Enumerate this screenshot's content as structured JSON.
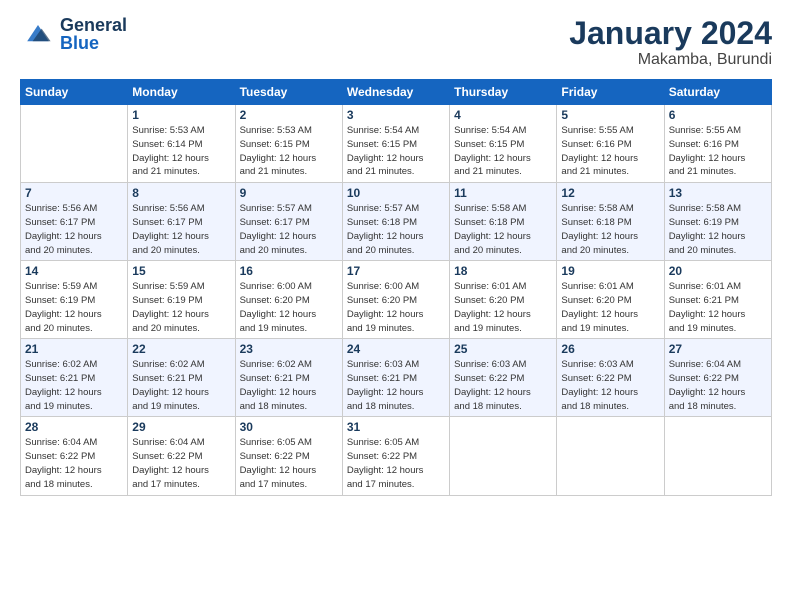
{
  "header": {
    "logo_general": "General",
    "logo_blue": "Blue",
    "month_year": "January 2024",
    "location": "Makamba, Burundi"
  },
  "weekdays": [
    "Sunday",
    "Monday",
    "Tuesday",
    "Wednesday",
    "Thursday",
    "Friday",
    "Saturday"
  ],
  "weeks": [
    [
      {
        "day": "",
        "info": ""
      },
      {
        "day": "1",
        "info": "Sunrise: 5:53 AM\nSunset: 6:14 PM\nDaylight: 12 hours\nand 21 minutes."
      },
      {
        "day": "2",
        "info": "Sunrise: 5:53 AM\nSunset: 6:15 PM\nDaylight: 12 hours\nand 21 minutes."
      },
      {
        "day": "3",
        "info": "Sunrise: 5:54 AM\nSunset: 6:15 PM\nDaylight: 12 hours\nand 21 minutes."
      },
      {
        "day": "4",
        "info": "Sunrise: 5:54 AM\nSunset: 6:15 PM\nDaylight: 12 hours\nand 21 minutes."
      },
      {
        "day": "5",
        "info": "Sunrise: 5:55 AM\nSunset: 6:16 PM\nDaylight: 12 hours\nand 21 minutes."
      },
      {
        "day": "6",
        "info": "Sunrise: 5:55 AM\nSunset: 6:16 PM\nDaylight: 12 hours\nand 21 minutes."
      }
    ],
    [
      {
        "day": "7",
        "info": "Sunrise: 5:56 AM\nSunset: 6:17 PM\nDaylight: 12 hours\nand 20 minutes."
      },
      {
        "day": "8",
        "info": "Sunrise: 5:56 AM\nSunset: 6:17 PM\nDaylight: 12 hours\nand 20 minutes."
      },
      {
        "day": "9",
        "info": "Sunrise: 5:57 AM\nSunset: 6:17 PM\nDaylight: 12 hours\nand 20 minutes."
      },
      {
        "day": "10",
        "info": "Sunrise: 5:57 AM\nSunset: 6:18 PM\nDaylight: 12 hours\nand 20 minutes."
      },
      {
        "day": "11",
        "info": "Sunrise: 5:58 AM\nSunset: 6:18 PM\nDaylight: 12 hours\nand 20 minutes."
      },
      {
        "day": "12",
        "info": "Sunrise: 5:58 AM\nSunset: 6:18 PM\nDaylight: 12 hours\nand 20 minutes."
      },
      {
        "day": "13",
        "info": "Sunrise: 5:58 AM\nSunset: 6:19 PM\nDaylight: 12 hours\nand 20 minutes."
      }
    ],
    [
      {
        "day": "14",
        "info": "Sunrise: 5:59 AM\nSunset: 6:19 PM\nDaylight: 12 hours\nand 20 minutes."
      },
      {
        "day": "15",
        "info": "Sunrise: 5:59 AM\nSunset: 6:19 PM\nDaylight: 12 hours\nand 20 minutes."
      },
      {
        "day": "16",
        "info": "Sunrise: 6:00 AM\nSunset: 6:20 PM\nDaylight: 12 hours\nand 19 minutes."
      },
      {
        "day": "17",
        "info": "Sunrise: 6:00 AM\nSunset: 6:20 PM\nDaylight: 12 hours\nand 19 minutes."
      },
      {
        "day": "18",
        "info": "Sunrise: 6:01 AM\nSunset: 6:20 PM\nDaylight: 12 hours\nand 19 minutes."
      },
      {
        "day": "19",
        "info": "Sunrise: 6:01 AM\nSunset: 6:20 PM\nDaylight: 12 hours\nand 19 minutes."
      },
      {
        "day": "20",
        "info": "Sunrise: 6:01 AM\nSunset: 6:21 PM\nDaylight: 12 hours\nand 19 minutes."
      }
    ],
    [
      {
        "day": "21",
        "info": "Sunrise: 6:02 AM\nSunset: 6:21 PM\nDaylight: 12 hours\nand 19 minutes."
      },
      {
        "day": "22",
        "info": "Sunrise: 6:02 AM\nSunset: 6:21 PM\nDaylight: 12 hours\nand 19 minutes."
      },
      {
        "day": "23",
        "info": "Sunrise: 6:02 AM\nSunset: 6:21 PM\nDaylight: 12 hours\nand 18 minutes."
      },
      {
        "day": "24",
        "info": "Sunrise: 6:03 AM\nSunset: 6:21 PM\nDaylight: 12 hours\nand 18 minutes."
      },
      {
        "day": "25",
        "info": "Sunrise: 6:03 AM\nSunset: 6:22 PM\nDaylight: 12 hours\nand 18 minutes."
      },
      {
        "day": "26",
        "info": "Sunrise: 6:03 AM\nSunset: 6:22 PM\nDaylight: 12 hours\nand 18 minutes."
      },
      {
        "day": "27",
        "info": "Sunrise: 6:04 AM\nSunset: 6:22 PM\nDaylight: 12 hours\nand 18 minutes."
      }
    ],
    [
      {
        "day": "28",
        "info": "Sunrise: 6:04 AM\nSunset: 6:22 PM\nDaylight: 12 hours\nand 18 minutes."
      },
      {
        "day": "29",
        "info": "Sunrise: 6:04 AM\nSunset: 6:22 PM\nDaylight: 12 hours\nand 17 minutes."
      },
      {
        "day": "30",
        "info": "Sunrise: 6:05 AM\nSunset: 6:22 PM\nDaylight: 12 hours\nand 17 minutes."
      },
      {
        "day": "31",
        "info": "Sunrise: 6:05 AM\nSunset: 6:22 PM\nDaylight: 12 hours\nand 17 minutes."
      },
      {
        "day": "",
        "info": ""
      },
      {
        "day": "",
        "info": ""
      },
      {
        "day": "",
        "info": ""
      }
    ]
  ]
}
